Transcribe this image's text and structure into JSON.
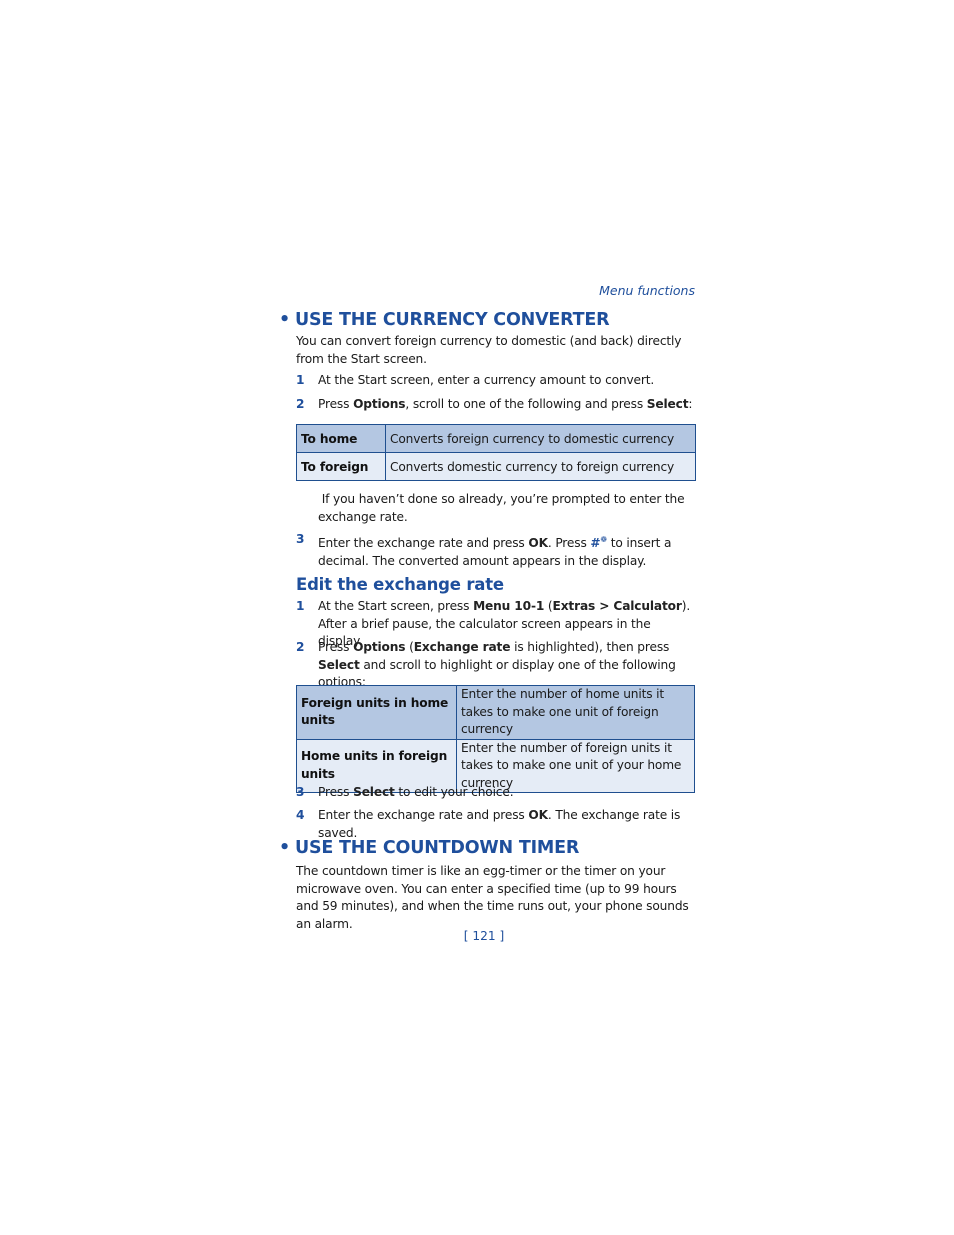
{
  "running_head": "Menu functions",
  "section1": {
    "title": "USE THE CURRENCY CONVERTER",
    "intro": "You can convert foreign currency to domestic (and back) directly from the Start screen.",
    "steps": [
      {
        "num": "1",
        "text": "At the Start screen, enter a currency amount to convert."
      },
      {
        "num": "2",
        "pre": "Press ",
        "b1": "Options",
        "mid": ", scroll to one of the following and press ",
        "b2": "Select",
        "post": ":"
      }
    ],
    "table": [
      {
        "key": "To home",
        "desc": "Converts foreign currency to domestic currency"
      },
      {
        "key": "To foreign",
        "desc": "Converts domestic currency to foreign currency"
      }
    ],
    "note": " If you haven’t done so already, you’re prompted to enter the exchange rate.",
    "step3": {
      "num": "3",
      "pre": "Enter the exchange rate and press ",
      "b1": "OK",
      "mid": ". Press ",
      "key": "#",
      "key_sup": "❁",
      "post": " to insert a decimal. The converted amount appears in the display."
    }
  },
  "subsection": {
    "title": "Edit the exchange rate",
    "steps": [
      {
        "num": "1",
        "pre": "At the Start screen, press ",
        "b1": "Menu 10-1",
        "mid": " (",
        "b2": "Extras > Calculator",
        "post": "). After a brief pause, the calculator screen appears in the display."
      },
      {
        "num": "2",
        "pre": "Press ",
        "b1": "Options",
        "mid": " (",
        "b2": "Exchange rate",
        "mid2": " is highlighted), then press ",
        "b3": "Select",
        "post": " and scroll to highlight or display one of the following options:"
      }
    ],
    "table": [
      {
        "key": "Foreign units in home units",
        "desc": "Enter the number of home units it takes to make one unit of foreign currency"
      },
      {
        "key": "Home units in foreign units",
        "desc": "Enter the number of foreign units it takes to make one unit of your home currency"
      }
    ],
    "steps2": [
      {
        "num": "3",
        "pre": "Press ",
        "b1": "Select",
        "post": " to edit your choice."
      },
      {
        "num": "4",
        "pre": "Enter the exchange rate and press ",
        "b1": "OK",
        "post": ". The exchange rate is saved."
      }
    ]
  },
  "section2": {
    "title": "USE THE COUNTDOWN TIMER",
    "intro": "The countdown timer is like an egg-timer or the timer on your microwave oven. You can enter a specified time (up to 99 hours and 59 minutes), and when the time runs out, your phone sounds an alarm."
  },
  "page_number": "[ 121 ]",
  "bullet": "•",
  "colors": {
    "accent": "#1f4f9c",
    "table_header_row": "#b4c7e2",
    "table_row": "#e5ecf6",
    "table_border": "#1f4f8f"
  }
}
